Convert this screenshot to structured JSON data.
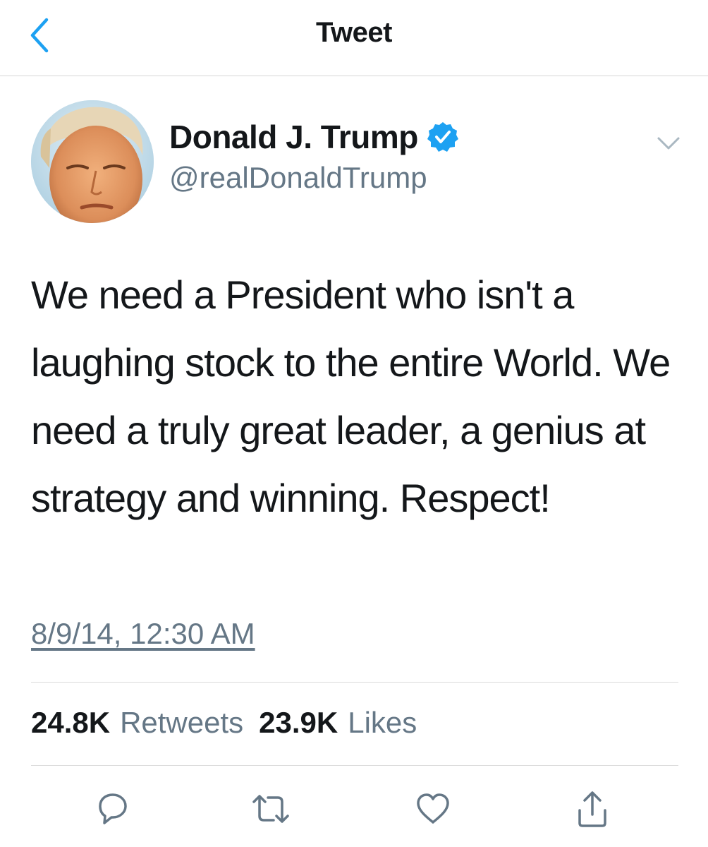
{
  "nav": {
    "title": "Tweet"
  },
  "tweet": {
    "display_name": "Donald J. Trump",
    "handle": "@realDonaldTrump",
    "verified": true,
    "text": "We need a President who isn't a laughing stock to the entire World. We need a truly great leader, a genius at strategy and winning. Respect!",
    "timestamp": "8/9/14, 12:30 AM",
    "retweets_count": "24.8K",
    "retweets_label": "Retweets",
    "likes_count": "23.9K",
    "likes_label": "Likes"
  },
  "icons": {
    "back": "chevron-left-icon",
    "more": "chevron-down-icon",
    "verified": "verified-badge-icon",
    "reply": "reply-icon",
    "retweet": "retweet-icon",
    "like": "heart-icon",
    "share": "share-icon"
  },
  "colors": {
    "accent": "#1da1f2",
    "text_primary": "#14171a",
    "text_secondary": "#657786",
    "divider": "#dcdcdc"
  }
}
